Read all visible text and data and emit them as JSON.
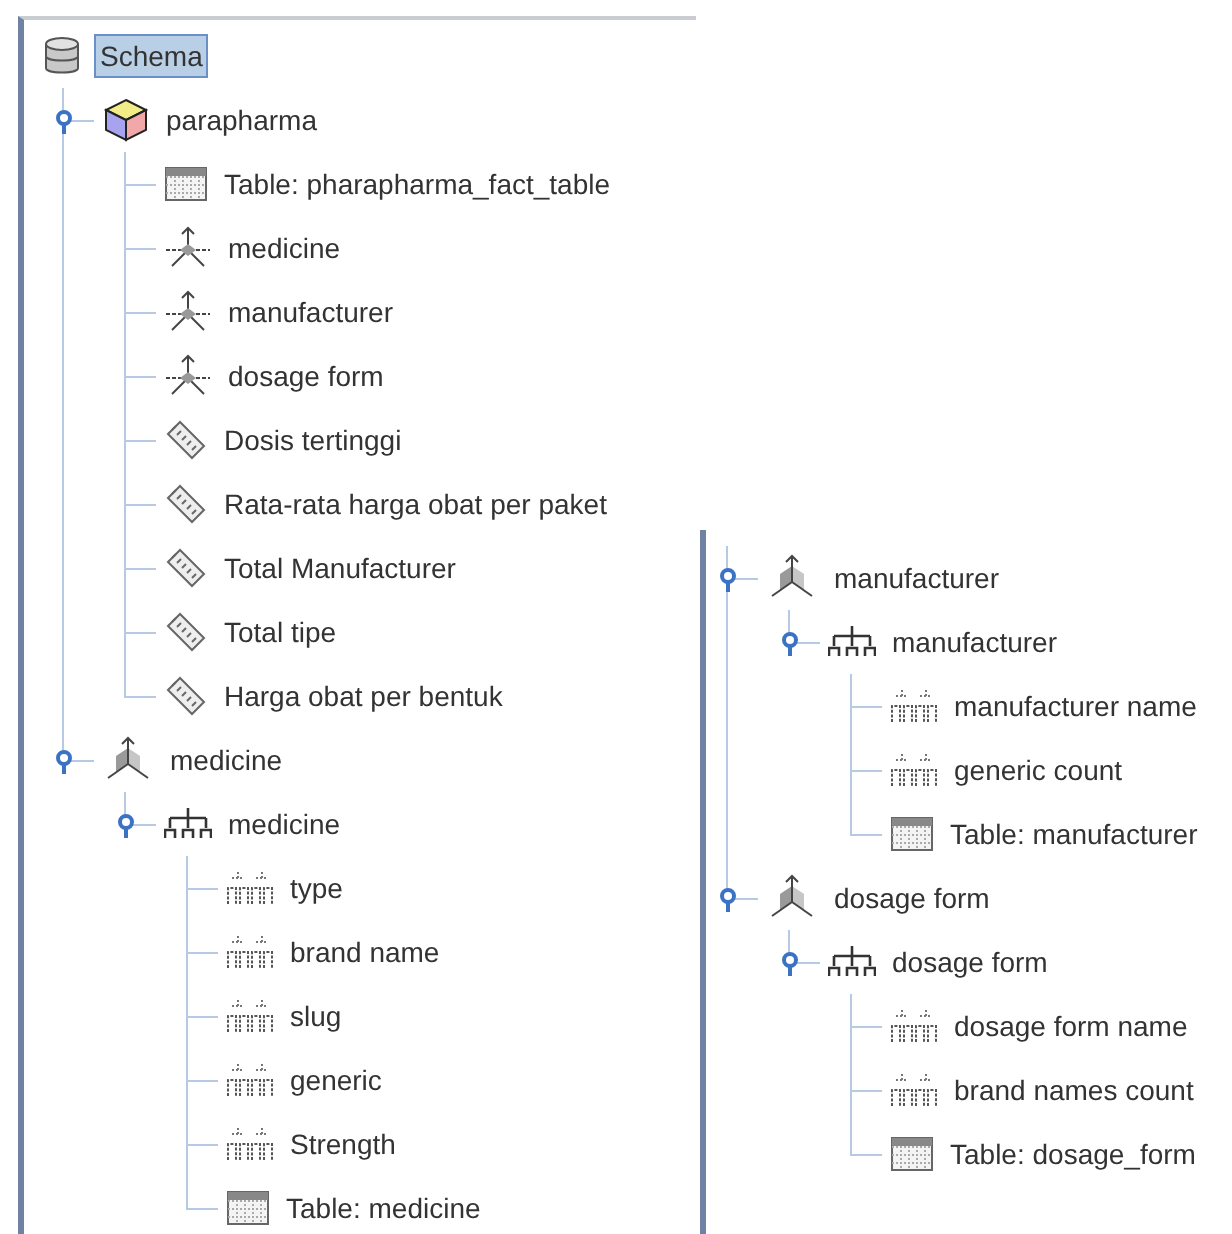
{
  "panels": [
    {
      "tree": [
        {
          "kind": "schema",
          "label": "Schema",
          "selected": true,
          "children": [
            {
              "kind": "cube",
              "label": "parapharma",
              "selected": false,
              "expanded": true,
              "children": [
                {
                  "kind": "table",
                  "label": "Table: pharapharma_fact_table",
                  "selected": false
                },
                {
                  "kind": "dimension_usage",
                  "label": "medicine",
                  "selected": false
                },
                {
                  "kind": "dimension_usage",
                  "label": "manufacturer",
                  "selected": false
                },
                {
                  "kind": "dimension_usage",
                  "label": "dosage form",
                  "selected": false
                },
                {
                  "kind": "measure",
                  "label": "Dosis tertinggi",
                  "selected": false
                },
                {
                  "kind": "measure",
                  "label": "Rata-rata harga obat per paket",
                  "selected": false
                },
                {
                  "kind": "measure",
                  "label": "Total Manufacturer",
                  "selected": false
                },
                {
                  "kind": "measure",
                  "label": "Total tipe",
                  "selected": false
                },
                {
                  "kind": "measure",
                  "label": "Harga obat per bentuk",
                  "selected": false
                }
              ]
            },
            {
              "kind": "dimension",
              "label": "medicine",
              "selected": false,
              "expanded": true,
              "children": [
                {
                  "kind": "hierarchy",
                  "label": "medicine",
                  "selected": false,
                  "expanded": true,
                  "children": [
                    {
                      "kind": "level",
                      "label": "type",
                      "selected": false
                    },
                    {
                      "kind": "level",
                      "label": "brand name",
                      "selected": false
                    },
                    {
                      "kind": "level",
                      "label": "slug",
                      "selected": false
                    },
                    {
                      "kind": "level",
                      "label": "generic",
                      "selected": false
                    },
                    {
                      "kind": "level",
                      "label": "Strength",
                      "selected": false
                    },
                    {
                      "kind": "table",
                      "label": "Table: medicine",
                      "selected": false
                    }
                  ]
                }
              ]
            }
          ]
        }
      ]
    },
    {
      "tree": [
        {
          "kind": "dimension",
          "label": "manufacturer",
          "selected": false,
          "expanded": true,
          "children": [
            {
              "kind": "hierarchy",
              "label": "manufacturer",
              "selected": false,
              "expanded": true,
              "children": [
                {
                  "kind": "level",
                  "label": "manufacturer name",
                  "selected": false
                },
                {
                  "kind": "level",
                  "label": "generic count",
                  "selected": false
                },
                {
                  "kind": "table",
                  "label": "Table: manufacturer",
                  "selected": false
                }
              ]
            }
          ]
        },
        {
          "kind": "dimension",
          "label": "dosage form",
          "selected": false,
          "expanded": true,
          "children": [
            {
              "kind": "hierarchy",
              "label": "dosage form",
              "selected": false,
              "expanded": true,
              "children": [
                {
                  "kind": "level",
                  "label": "dosage form name",
                  "selected": false
                },
                {
                  "kind": "level",
                  "label": "brand names count",
                  "selected": false
                },
                {
                  "kind": "table",
                  "label": "Table: dosage_form",
                  "selected": false
                }
              ]
            }
          ]
        }
      ]
    }
  ]
}
